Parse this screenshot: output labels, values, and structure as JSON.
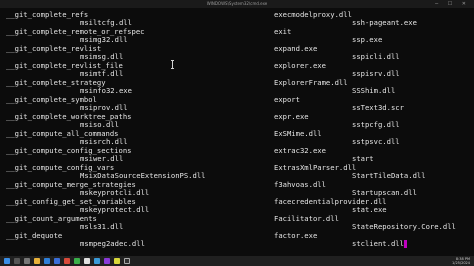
{
  "window": {
    "title": "WINDOWS\\System32\\cmd.exe",
    "controls": "─ ☐ ✕"
  },
  "terminal": {
    "col1": [
      "__git_complete_refs",
      "msiltcfg.dll",
      "__git_complete_remote_or_refspec",
      "msimg32.dll",
      "__git_complete_revlist",
      "msimsg.dll",
      "__git_complete_revlist_file",
      "msimtf.dll",
      "__git_complete_strategy",
      "msinfo32.exe",
      "__git_complete_symbol",
      "msiprov.dll",
      "__git_complete_worktree_paths",
      "msiso.dll",
      "__git_compute_all_commands",
      "msisrch.dll",
      "__git_compute_config_sections",
      "msiwer.dll",
      "__git_compute_config_vars",
      "MsixDataSourceExtensionPS.dll",
      "__git_compute_merge_strategies",
      "mskeyprotcli.dll",
      "__git_config_get_set_variables",
      "mskeyprotect.dll",
      "__git_count_arguments",
      "msls31.dll",
      "__git_dequote",
      "msmpeg2adec.dll"
    ],
    "col2": [
      "execmodelproxy.dll",
      "exit",
      "expand.exe",
      "explorer.exe",
      "ExplorerFrame.dll",
      "export",
      "expr.exe",
      "ExSMime.dll",
      "extrac32.exe",
      "ExtrasXmlParser.dll",
      "f3ahvoas.dll",
      "facecredentialprovider.dll",
      "Facilitator.dll",
      "factor.exe"
    ],
    "col3": [
      "ssh-pageant.exe",
      "ssp.exe",
      "sspicli.dll",
      "sspisrv.dll",
      "SSShim.dll",
      "ssText3d.scr",
      "sstpcfg.dll",
      "sstpsvc.dll",
      "start",
      "StartTileData.dll",
      "Startupscan.dll",
      "stat.exe",
      "StateRepository.Core.dll",
      "stclient.dll"
    ]
  },
  "taskbar": {
    "time": "8:38 PM",
    "date": "1/25/2024"
  }
}
